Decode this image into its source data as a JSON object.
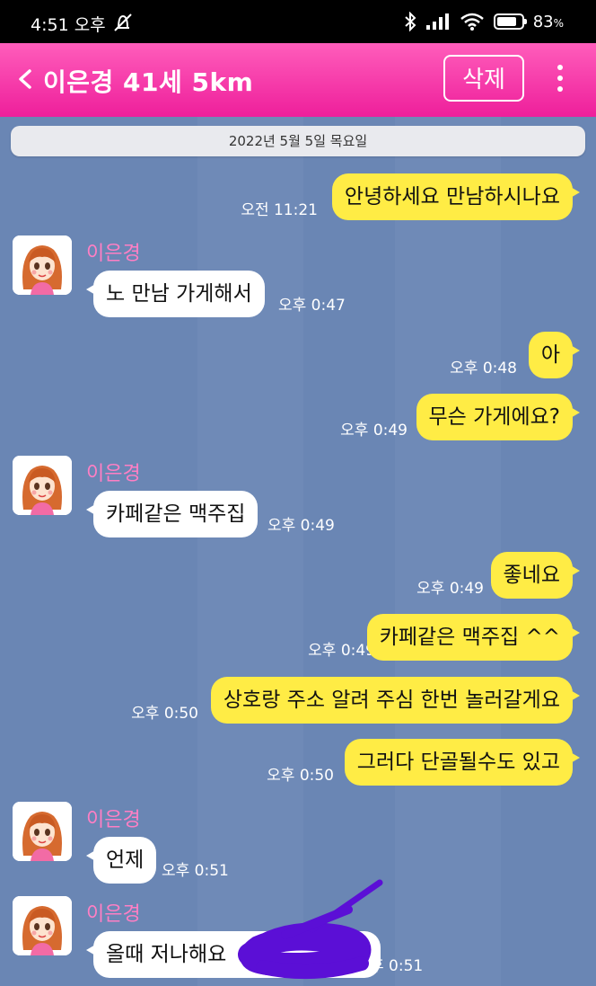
{
  "status_bar": {
    "time": "4:51 오후",
    "battery": "83",
    "battery_unit": "%",
    "battery_level": 0.83
  },
  "header": {
    "title": "이은경 41세 5km",
    "delete_label": "삭제"
  },
  "chat": {
    "date": "2022년 5월 5일 목요일",
    "messages": [
      {
        "side": "me",
        "text": "안녕하세요 만남하시나요",
        "time": "오전 11:21"
      },
      {
        "side": "them",
        "sender": "이은경",
        "text": "노 만남  가게해서",
        "time": "오후 0:47"
      },
      {
        "side": "me",
        "text": "아",
        "time": "오후 0:48"
      },
      {
        "side": "me",
        "text": "무슨 가게에요?",
        "time": "오후 0:49"
      },
      {
        "side": "them",
        "sender": "이은경",
        "text": "카페같은 맥주집",
        "time": "오후 0:49"
      },
      {
        "side": "me",
        "text": "좋네요",
        "time": "오후 0:49"
      },
      {
        "side": "me",
        "text": "카페같은 맥주집 ^^",
        "time": "오후 0:49"
      },
      {
        "side": "me",
        "text": "상호랑 주소 알려 주심 한번 놀러갈게요",
        "time": "오후 0:50"
      },
      {
        "side": "me",
        "text": "그러다 단골될수도 있고",
        "time": "오후 0:50"
      },
      {
        "side": "them",
        "sender": "이은경",
        "text": "언제",
        "time": "오후 0:51"
      },
      {
        "side": "them",
        "sender": "이은경",
        "text": "올때 저나해요",
        "time": "후 0:51"
      }
    ]
  },
  "colors": {
    "header_pink": "#ee1f9b",
    "chat_bg": "#6a86b4",
    "my_bubble": "#ffec45",
    "their_bubble": "#ffffff",
    "sender_name": "#ff7fc4",
    "redaction": "#5b0fd6"
  },
  "icons": [
    "mute-icon",
    "bluetooth-icon",
    "signal-icon",
    "wifi-icon",
    "battery-icon",
    "back-chevron-icon",
    "more-vertical-icon",
    "avatar-icon"
  ]
}
